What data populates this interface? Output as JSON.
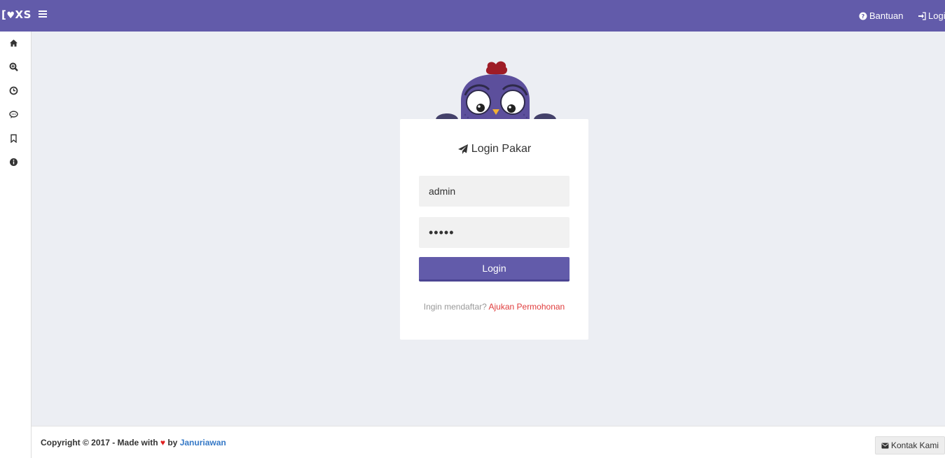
{
  "topbar": {
    "logo_left": "[",
    "logo_heart": "♥",
    "logo_right": "XS",
    "help_label": "Bantuan",
    "login_label": "Login"
  },
  "sidebar": {
    "items": [
      {
        "icon": "home-icon"
      },
      {
        "icon": "zoom-icon"
      },
      {
        "icon": "clock-icon"
      },
      {
        "icon": "chat-icon"
      },
      {
        "icon": "bookmark-icon"
      },
      {
        "icon": "info-icon"
      }
    ]
  },
  "login": {
    "title": "Login Pakar",
    "username_value": "admin",
    "password_value": "•••••",
    "button_label": "Login",
    "register_prompt": "Ingin mendaftar?",
    "register_link": "Ajukan Permohonan"
  },
  "footer": {
    "copyright_prefix": "Copyright © 2017 - Made with",
    "heart": "♥",
    "by": "by",
    "author": "Januriawan",
    "contact_label": "Kontak Kami"
  },
  "colors": {
    "accent": "#625BAA",
    "background": "#ECEEF3",
    "link_red": "#E03C3C",
    "link_blue": "#3478C6"
  }
}
